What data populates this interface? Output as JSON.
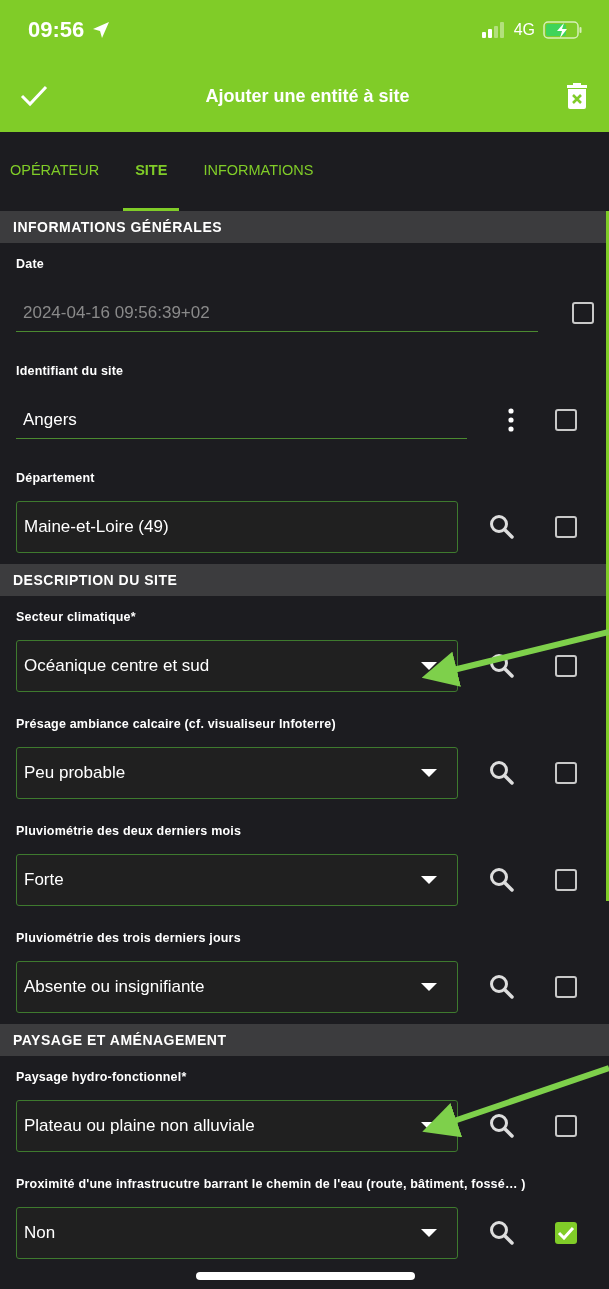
{
  "status_bar": {
    "time": "09:56",
    "network": "4G"
  },
  "header": {
    "title": "Ajouter une entité à site"
  },
  "tabs": [
    {
      "label": "OPÉRATEUR",
      "selected": false
    },
    {
      "label": "SITE",
      "selected": true
    },
    {
      "label": "INFORMATIONS",
      "selected": false
    }
  ],
  "sections": [
    {
      "title": "INFORMATIONS GÉNÉRALES",
      "fields": [
        {
          "kind": "readonly",
          "label": "Date",
          "value": "2024-04-16 09:56:39+02",
          "checked": false
        },
        {
          "kind": "text",
          "label": "Identifiant du site",
          "value": "Angers",
          "checked": false
        },
        {
          "kind": "input",
          "label": "Département",
          "value": "Maine-et-Loire (49)",
          "checked": false
        }
      ]
    },
    {
      "title": "DESCRIPTION DU SITE",
      "fields": [
        {
          "kind": "select",
          "label": "Secteur climatique*",
          "value": "Océanique centre et sud",
          "checked": false
        },
        {
          "kind": "select",
          "label": "Présage ambiance calcaire (cf. visualiseur Infoterre)",
          "value": "Peu probable",
          "checked": false
        },
        {
          "kind": "select",
          "label": "Pluviométrie des deux derniers mois",
          "value": "Forte",
          "checked": false
        },
        {
          "kind": "select",
          "label": "Pluviométrie des trois derniers jours",
          "value": "Absente ou insignifiante",
          "checked": false
        }
      ]
    },
    {
      "title": "PAYSAGE ET AMÉNAGEMENT",
      "fields": [
        {
          "kind": "select",
          "label": "Paysage hydro-fonctionnel*",
          "value": "Plateau ou plaine non alluviale",
          "checked": false
        },
        {
          "kind": "select",
          "label": "Proximité d'une infrastrucutre barrant le chemin de l'eau (route, bâtiment, fossé… )",
          "value": "Non",
          "checked": true
        }
      ]
    }
  ]
}
